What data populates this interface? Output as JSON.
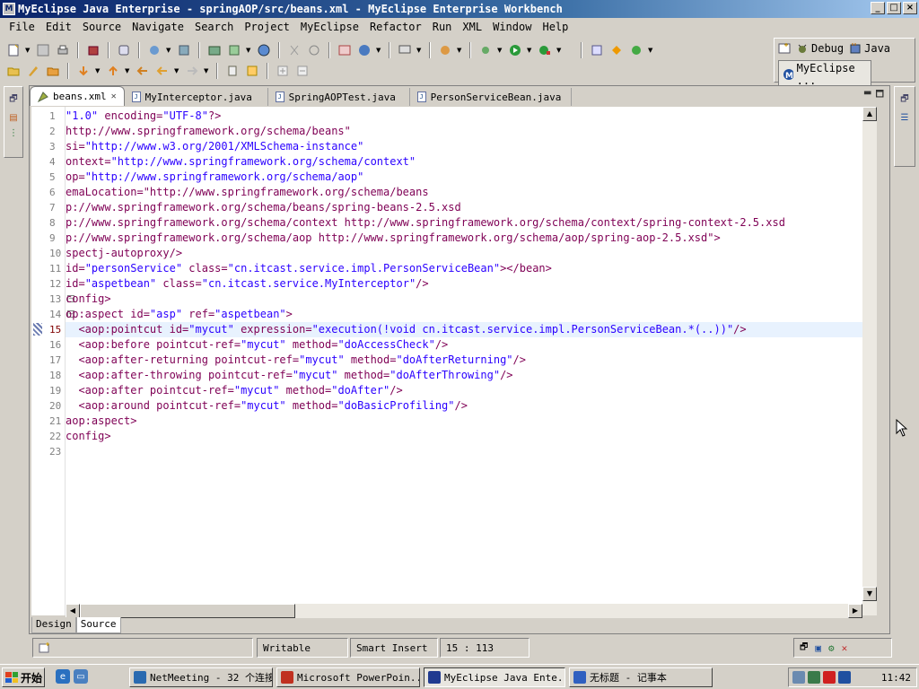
{
  "window": {
    "title": "MyEclipse Java Enterprise - springAOP/src/beans.xml - MyEclipse Enterprise Workbench",
    "min": "_",
    "max": "□",
    "close": "×"
  },
  "menu": [
    "File",
    "Edit",
    "Source",
    "Navigate",
    "Search",
    "Project",
    "MyEclipse",
    "Refactor",
    "Run",
    "XML",
    "Window",
    "Help"
  ],
  "perspectives": {
    "debug": "Debug",
    "java": "Java",
    "active": "MyEclipse ..."
  },
  "tabs": [
    {
      "label": "beans.xml",
      "active": true
    },
    {
      "label": "MyInterceptor.java",
      "active": false
    },
    {
      "label": "SpringAOPTest.java",
      "active": false
    },
    {
      "label": "PersonServiceBean.java",
      "active": false
    }
  ],
  "editor": {
    "current_line": 15,
    "lines": [
      "\"1.0\" encoding=\"UTF-8\"?>",
      "http://www.springframework.org/schema/beans\"",
      "si=\"http://www.w3.org/2001/XMLSchema-instance\"",
      "ontext=\"http://www.springframework.org/schema/context\"",
      "op=\"http://www.springframework.org/schema/aop\"",
      "emaLocation=\"http://www.springframework.org/schema/beans",
      "p://www.springframework.org/schema/beans/spring-beans-2.5.xsd",
      "p://www.springframework.org/schema/context http://www.springframework.org/schema/context/spring-context-2.5.xsd",
      "p://www.springframework.org/schema/aop http://www.springframework.org/schema/aop/spring-aop-2.5.xsd\">",
      "spectj-autoproxy/>",
      "id=\"personService\" class=\"cn.itcast.service.impl.PersonServiceBean\"></bean>",
      "id=\"aspetbean\" class=\"cn.itcast.service.MyInterceptor\"/>",
      "config>",
      "op:aspect id=\"asp\" ref=\"aspetbean\">",
      "  <aop:pointcut id=\"mycut\" expression=\"execution(!void cn.itcast.service.impl.PersonServiceBean.*(..))\"/>",
      "  <aop:before pointcut-ref=\"mycut\" method=\"doAccessCheck\"/>",
      "  <aop:after-returning pointcut-ref=\"mycut\" method=\"doAfterReturning\"/>",
      "  <aop:after-throwing pointcut-ref=\"mycut\" method=\"doAfterThrowing\"/>",
      "  <aop:after pointcut-ref=\"mycut\" method=\"doAfter\"/>",
      "  <aop:around pointcut-ref=\"mycut\" method=\"doBasicProfiling\"/>",
      "aop:aspect>",
      "config>",
      ""
    ]
  },
  "source_tabs": {
    "design": "Design",
    "source": "Source"
  },
  "status": {
    "writable": "Writable",
    "insert_mode": "Smart Insert",
    "position": "15 : 113"
  },
  "taskbar": {
    "start": "开始",
    "tasks": [
      {
        "label": "NetMeeting - 32 个连接",
        "color": "#2a6ab0"
      },
      {
        "label": "Microsoft PowerPoin...",
        "color": "#c03020"
      },
      {
        "label": "MyEclipse Java Ente...",
        "color": "#203a90",
        "active": true
      },
      {
        "label": "无标题 - 记事本",
        "color": "#3060c0"
      }
    ],
    "clock": "11:42"
  },
  "colors": {
    "title_start": "#0a246a",
    "title_end": "#a6caf0",
    "keyword": "#7f0055",
    "string": "#2a00ff",
    "current_line": "#e8f2fe"
  }
}
